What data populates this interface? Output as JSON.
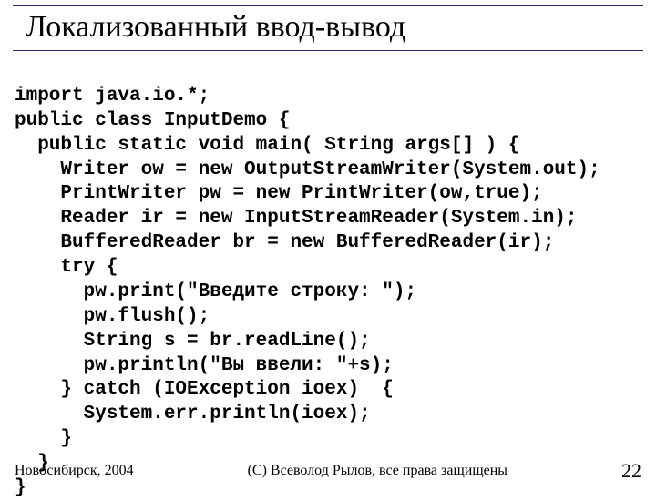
{
  "title": "Локализованный ввод-вывод",
  "code_lines": [
    "import java.io.*;",
    "public class InputDemo {",
    "  public static void main( String args[] ) {",
    "    Writer ow = new OutputStreamWriter(System.out);",
    "    PrintWriter pw = new PrintWriter(ow,true);",
    "    Reader ir = new InputStreamReader(System.in);",
    "    BufferedReader br = new BufferedReader(ir);",
    "    try {",
    "      pw.print(\"Введите строку: \");",
    "      pw.flush();",
    "      String s = br.readLine();",
    "      pw.println(\"Вы ввели: \"+s);",
    "    } catch (IOException ioex)  {",
    "      System.err.println(ioex);",
    "    }",
    "  }",
    "}"
  ],
  "footer": {
    "left": "Новосибирск, 2004",
    "center": "(С) Всеволод Рылов, все права защищены",
    "page": "22"
  }
}
